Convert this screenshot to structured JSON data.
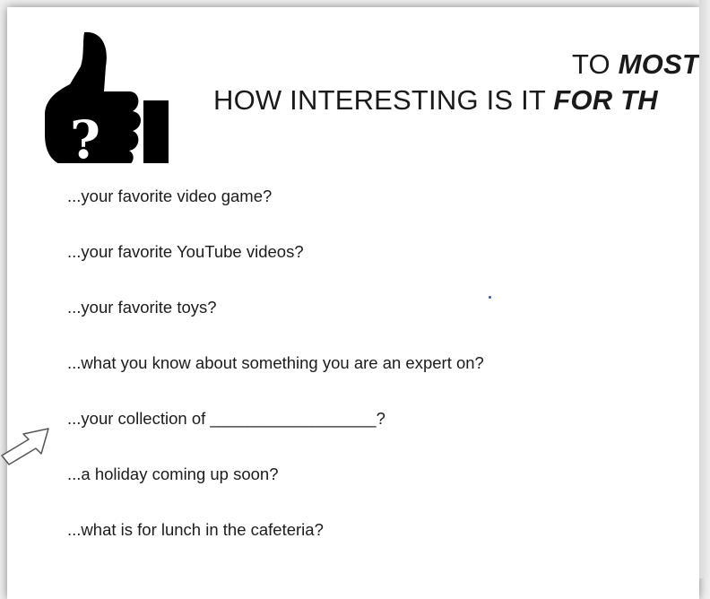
{
  "title": {
    "line1_prefix": "TO ",
    "line1_emph": "MOST",
    "line2_prefix": "HOW INTERESTING IS IT ",
    "line2_emph": "FOR TH"
  },
  "items": [
    "...your favorite video game?",
    "...your favorite YouTube videos?",
    "...your favorite toys?",
    "...what you know about something you are an expert on?",
    "...your collection of __________________?",
    "...a holiday coming up soon?",
    "...what is for lunch in the cafeteria?"
  ],
  "icons": {
    "thumb": "thumbs-up-question-icon",
    "arrow": "pointer-arrow-icon"
  }
}
